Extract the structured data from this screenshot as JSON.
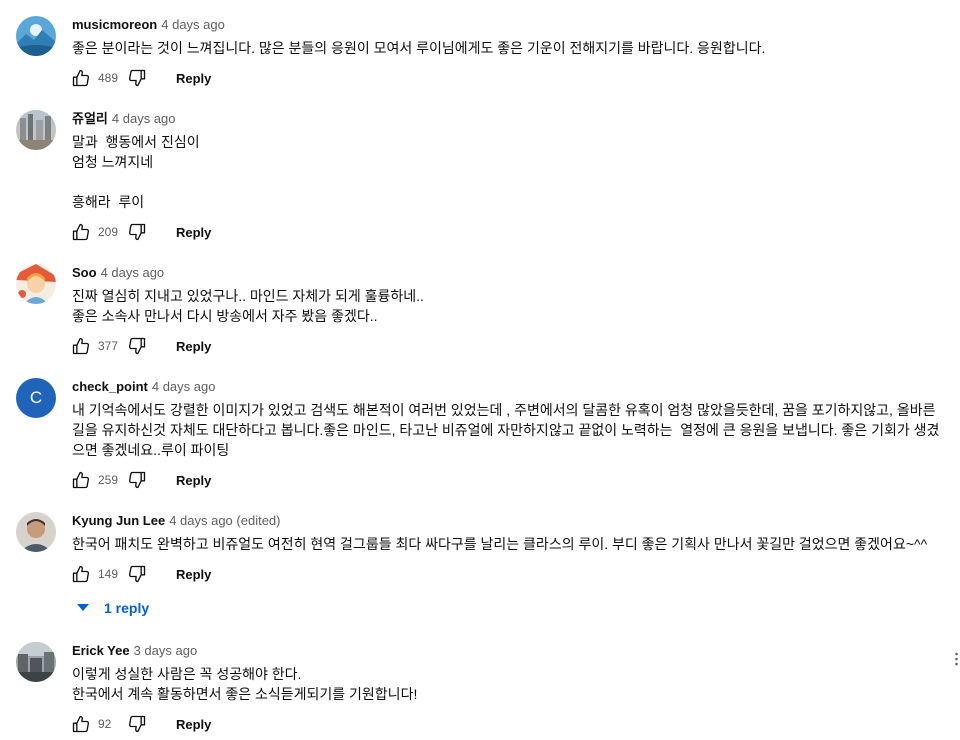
{
  "comments": [
    {
      "author": "musicmoreon",
      "time": "4 days ago",
      "lines": [
        "좋은 분이라는 것이 느껴집니다. 많은 분들의 응원이 모여서 루이님에게도 좋은 기운이 전해지기를 바랍니다. 응원합니다."
      ],
      "likes": "489",
      "reply_label": "Reply",
      "avatar_icon": "landscape-avatar-icon"
    },
    {
      "author": "쥬얼리",
      "time": "4 days ago",
      "lines": [
        "말과  행동에서 진심이",
        "엄청 느껴지네",
        "",
        "흥해라  루이"
      ],
      "likes": "209",
      "reply_label": "Reply",
      "avatar_icon": "city-photo-avatar-icon"
    },
    {
      "author": "Soo",
      "time": "4 days ago",
      "lines": [
        "진짜 열심히 지내고 있었구나.. 마인드 자체가 되게 훌륭하네..",
        "좋은 소속사 만나서 다시 방송에서 자주 봤음 좋겠다.."
      ],
      "likes": "377",
      "reply_label": "Reply",
      "avatar_icon": "illustration-avatar-icon"
    },
    {
      "author": "check_point",
      "time": "4 days ago",
      "lines": [
        "내 기억속에서도 강렬한 이미지가 있었고 검색도 해본적이 여러번 있었는데 , 주변에서의 달콤한 유혹이 엄청 많았을듯한데, 꿈을 포기하지않고, 올바른 길을 유지하신것 자체도 대단하다고 봅니다.좋은 마인드, 타고난 비쥬얼에 자만하지않고 끝없이 노력하는  열정에 큰 응원을 보냅니다. 좋은 기회가 생겼으면 좋겠네요..루이 파이팅"
      ],
      "likes": "259",
      "reply_label": "Reply",
      "avatar_letter": "C"
    },
    {
      "author": "Kyung Jun Lee",
      "time": "4 days ago (edited)",
      "lines": [
        "한국어 패치도 완벽하고 비쥬얼도 여전히 현역 걸그룹들 최다 싸다구를 날리는 클라스의 루이. 부디 좋은 기획사 만나서 꽃길만 걸었으면 좋겠어요~^^"
      ],
      "likes": "149",
      "reply_label": "Reply",
      "replies_label": "1 reply",
      "avatar_icon": "person-photo-avatar-icon"
    },
    {
      "author": "Erick Yee",
      "time": "3 days ago",
      "lines": [
        "이렇게 성실한 사람은 꼭 성공해야 한다.",
        "한국에서 계속 활동하면서 좋은 소식듣게되기를 기원합니다!"
      ],
      "likes": "92",
      "reply_label": "Reply",
      "avatar_icon": "street-photo-avatar-icon"
    }
  ],
  "colors": {
    "text": "#0f0f0f",
    "secondary": "#606060",
    "link": "#065fd4",
    "letter_avatar": "#1f64b8"
  }
}
